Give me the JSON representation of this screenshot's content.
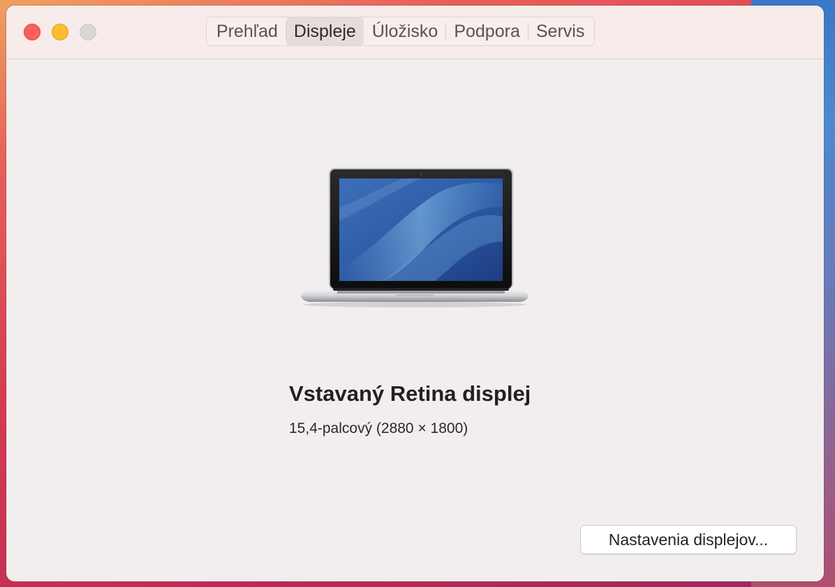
{
  "window": {
    "tabs": [
      {
        "label": "Prehľad",
        "active": false
      },
      {
        "label": "Displeje",
        "active": true
      },
      {
        "label": "Úložisko",
        "active": false
      },
      {
        "label": "Podpora",
        "active": false
      },
      {
        "label": "Servis",
        "active": false
      }
    ]
  },
  "display": {
    "name": "Vstavaný Retina displej",
    "size": "15,4-palcový (2880 × 1800)",
    "illustration_icon": "macbook-pro-laptop-icon"
  },
  "actions": {
    "settings_button_label": "Nastavenia displejov..."
  },
  "colors": {
    "close": "#fe5f57",
    "minimize": "#febc2e",
    "zoom_inactive": "#ddd6d6"
  }
}
